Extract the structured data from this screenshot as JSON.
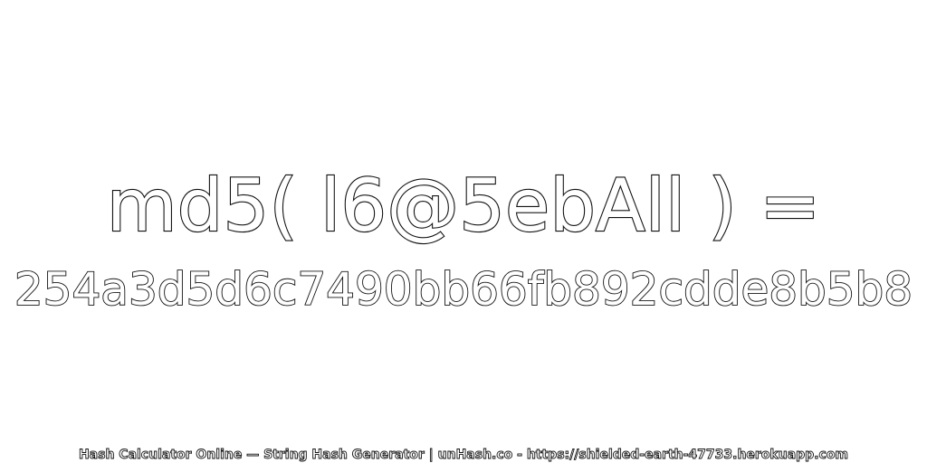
{
  "hash": {
    "expression": "md5( l6@5ebAll ) =",
    "result": "254a3d5d6c7490bb66fb892cdde8b5b8"
  },
  "footer": {
    "text": "Hash Calculator Online — String Hash Generator | unHash.co - https://shielded-earth-47733.herokuapp.com"
  },
  "colors": {
    "background": "#ffffff",
    "text_fill": "#ffffff",
    "text_stroke": "#111111"
  }
}
